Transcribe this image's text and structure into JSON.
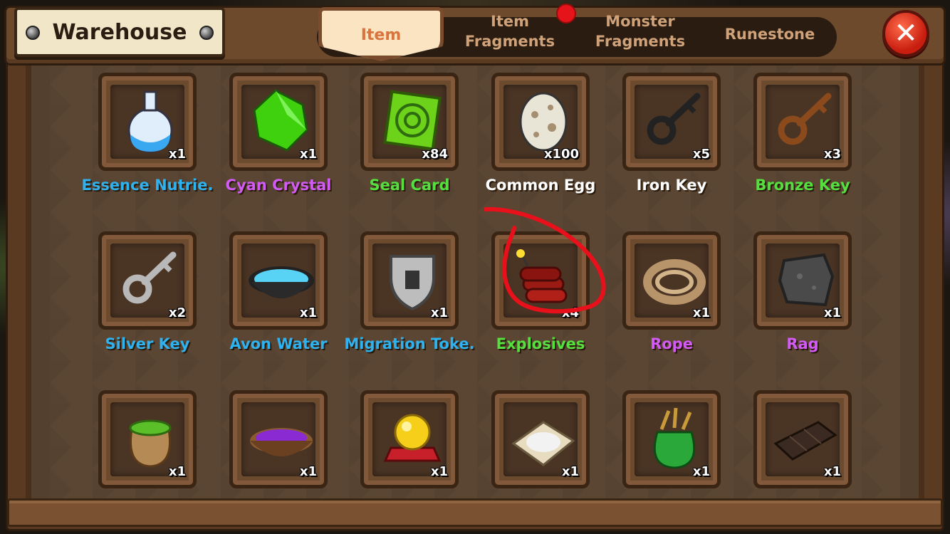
{
  "window": {
    "title": "Warehouse",
    "close_label": "✕"
  },
  "tabs": [
    {
      "label": "Item",
      "active": true
    },
    {
      "label": "Item\nFragments",
      "line1": "Item",
      "line2": "Fragments",
      "active": false
    },
    {
      "label": "Monster\nFragments",
      "line1": "Monster",
      "line2": "Fragments",
      "active": false,
      "notification": true
    },
    {
      "label": "Runestone",
      "active": false
    }
  ],
  "colors": {
    "blue": "#2fb3f0",
    "purple": "#d25bf5",
    "green": "#55e040",
    "white": "#ffffff"
  },
  "items": [
    {
      "name": "Essence Nutrie.",
      "count": "x1",
      "icon": "flask-icon",
      "color": "#2fb3f0"
    },
    {
      "name": "Cyan Crystal",
      "count": "x1",
      "icon": "green-crystal-icon",
      "color": "#d25bf5"
    },
    {
      "name": "Seal Card",
      "count": "x84",
      "icon": "seal-card-icon",
      "color": "#55e040"
    },
    {
      "name": "Common Egg",
      "count": "x100",
      "icon": "egg-icon",
      "color": "#ffffff"
    },
    {
      "name": "Iron Key",
      "count": "x5",
      "icon": "iron-key-icon",
      "color": "#ffffff"
    },
    {
      "name": "Bronze Key",
      "count": "x3",
      "icon": "bronze-key-icon",
      "color": "#55e040"
    },
    {
      "name": "Silver Key",
      "count": "x2",
      "icon": "silver-key-icon",
      "color": "#2fb3f0"
    },
    {
      "name": "Avon Water",
      "count": "x1",
      "icon": "water-bowl-icon",
      "color": "#2fb3f0"
    },
    {
      "name": "Migration Toke.",
      "count": "x1",
      "icon": "shield-token-icon",
      "color": "#2fb3f0"
    },
    {
      "name": "Explosives",
      "count": "x4",
      "icon": "dynamite-icon",
      "color": "#55e040"
    },
    {
      "name": "Rope",
      "count": "x1",
      "icon": "rope-icon",
      "color": "#d25bf5"
    },
    {
      "name": "Rag",
      "count": "x1",
      "icon": "rag-icon",
      "color": "#d25bf5"
    },
    {
      "name": "",
      "count": "x1",
      "icon": "seed-sack-icon",
      "color": "#55e040"
    },
    {
      "name": "",
      "count": "x1",
      "icon": "purple-powder-bowl-icon",
      "color": "#ffffff"
    },
    {
      "name": "",
      "count": "x1",
      "icon": "golden-orb-icon",
      "color": "#ffffff"
    },
    {
      "name": "",
      "count": "x1",
      "icon": "salt-cloth-icon",
      "color": "#ffffff"
    },
    {
      "name": "",
      "count": "x1",
      "icon": "green-pouch-icon",
      "color": "#ffffff"
    },
    {
      "name": "",
      "count": "x1",
      "icon": "chocolate-bar-icon",
      "color": "#ffffff"
    }
  ]
}
